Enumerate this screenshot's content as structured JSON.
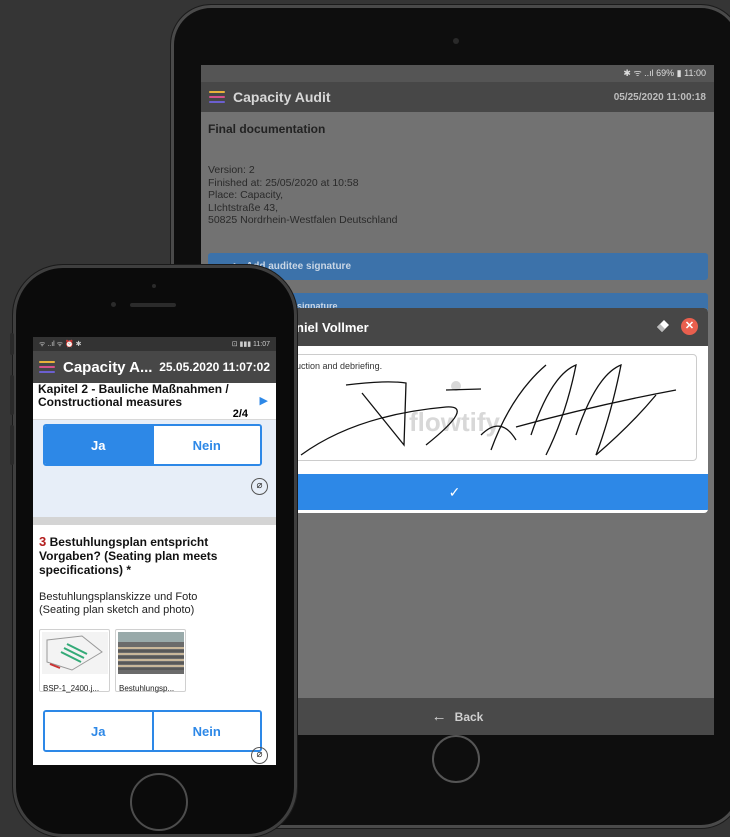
{
  "tablet": {
    "status": "✱ ᯤ ..ıl 69% ▮ 11:00",
    "app_title": "Capacity Audit",
    "app_date": "05/25/2020 11:00:18",
    "section_title": "Final documentation",
    "info_lines": [
      "Version: 2",
      "Finished at: 25/05/2020 at 10:58",
      "Place: Capacity,",
      "LIchtstraße 43,",
      "50825 Nordrhein-Westfalen Deutschland"
    ],
    "add_auditee_signature": "Add auditee signature",
    "second_button_partial": "signature",
    "dialog_title": "niel Vollmer",
    "signature_hint": "nduction and debriefing.",
    "watermark": "flowtify",
    "confirm_icon": "check-icon",
    "back_label": "Back"
  },
  "phone": {
    "status_left": "ᯤ ..ıl ᯤ ⏰ ✱",
    "status_right": "⊡ ▮▮▮ 11:07",
    "app_title": "Capacity A...",
    "app_date": "25.05.2020 11:07:02",
    "chapter_title": "Kapitel 2 - Bauliche Maßnahmen / Constructional measures",
    "chapter_count": "2/4",
    "q2_yes": "Ja",
    "q2_no": "Nein",
    "q3_number": "3",
    "q3_title": "Bestuhlungsplan entspricht Vorgaben? (Seating plan meets specifications)  *",
    "q3_desc_line1": "Bestuhlungsplanskizze und Foto",
    "q3_desc_line2": "(Seating plan sketch and photo)",
    "attachments": [
      {
        "name": "BSP-1_2400.j..."
      },
      {
        "name": "Bestuhlungsp..."
      }
    ],
    "q3_yes": "Ja",
    "q3_no": "Nein"
  },
  "colors": {
    "accent": "#2d88e7",
    "appbar": "#474747",
    "hamburger": [
      "#e9b13a",
      "#d64f8c",
      "#6b5fcf"
    ],
    "close": "#e95f4e"
  }
}
